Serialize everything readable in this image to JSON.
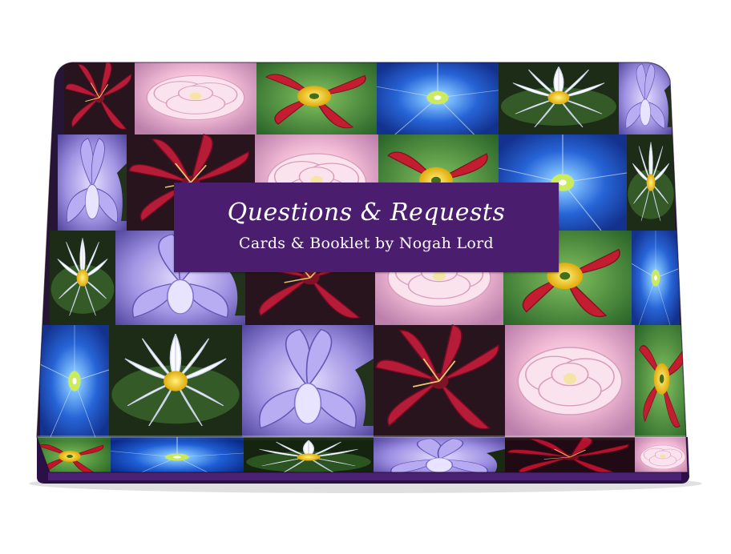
{
  "box": {
    "title": "Questions & Requests",
    "subtitle": "Cards & Booklet by Nogah Lord"
  },
  "colors": {
    "label_background": "#4a1d6e",
    "box_base": "#3a1458",
    "label_text": "#ffffff"
  },
  "tiles": [
    {
      "flower": "red-lily-icon"
    },
    {
      "flower": "pink-peony-icon"
    },
    {
      "flower": "red-daylily-icon"
    },
    {
      "flower": "blue-morning-glory-icon"
    },
    {
      "flower": "white-water-lily-icon"
    },
    {
      "flower": "purple-iris-icon"
    }
  ]
}
